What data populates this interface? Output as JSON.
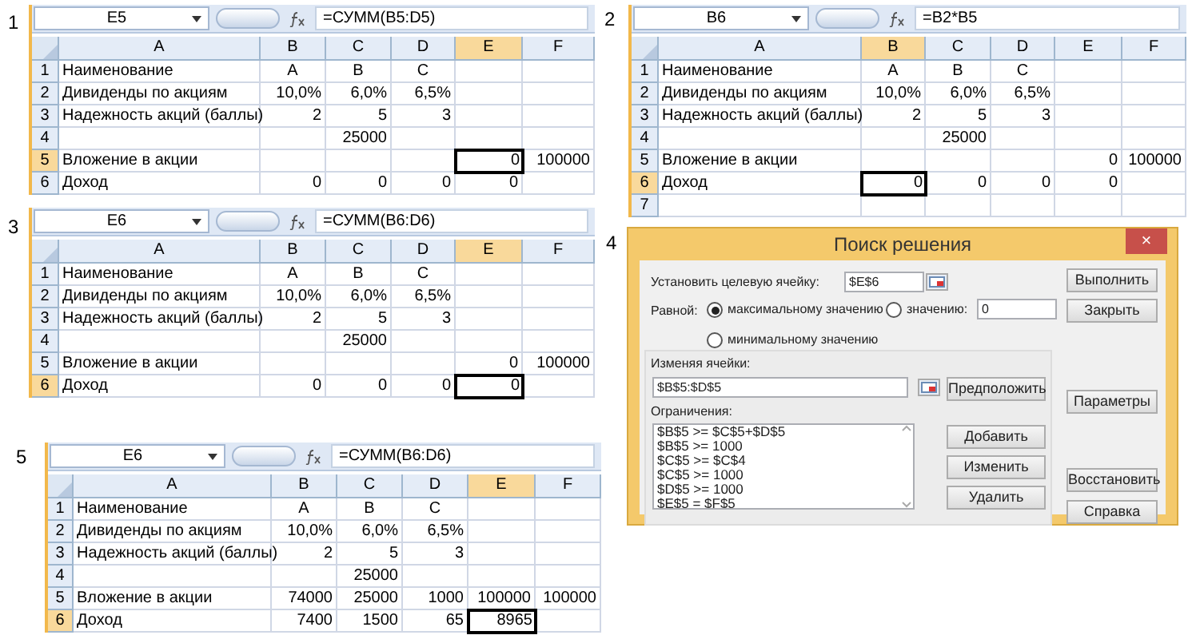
{
  "sheets": [
    {
      "label": "1",
      "name_box": "E5",
      "formula": "=СУММ(B5:D5)",
      "columns": [
        {
          "name": "A",
          "selected": false
        },
        {
          "name": "B",
          "selected": false
        },
        {
          "name": "C",
          "selected": false
        },
        {
          "name": "D",
          "selected": false
        },
        {
          "name": "E",
          "selected": true
        },
        {
          "name": "F",
          "selected": false
        }
      ],
      "rows": [
        {
          "number": "1",
          "selected": false,
          "cells": [
            "Наименование",
            "A",
            "B",
            "C",
            null,
            null
          ]
        },
        {
          "number": "2",
          "selected": false,
          "cells": [
            "Дивиденды по акциям",
            "10,0%",
            "6,0%",
            "6,5%",
            null,
            null
          ]
        },
        {
          "number": "3",
          "selected": false,
          "cells": [
            "Надежность акций (баллы)",
            "2",
            "5",
            "3",
            null,
            null
          ]
        },
        {
          "number": "4",
          "selected": false,
          "cells": [
            null,
            null,
            "25000",
            null,
            null,
            null
          ]
        },
        {
          "number": "5",
          "selected": true,
          "cells": [
            "Вложение в акции",
            null,
            null,
            null,
            "0",
            "100000"
          ]
        },
        {
          "number": "6",
          "selected": false,
          "cells": [
            "Доход",
            "0",
            "0",
            "0",
            "0",
            null
          ]
        }
      ]
    },
    {
      "label": "2",
      "name_box": "B6",
      "formula": "=B2*B5",
      "columns": [
        {
          "name": "A",
          "selected": false
        },
        {
          "name": "B",
          "selected": true
        },
        {
          "name": "C",
          "selected": false
        },
        {
          "name": "D",
          "selected": false
        },
        {
          "name": "E",
          "selected": false
        },
        {
          "name": "F",
          "selected": false
        }
      ],
      "rows": [
        {
          "number": "1",
          "selected": false,
          "cells": [
            "Наименование",
            "A",
            "B",
            "C",
            null,
            null
          ]
        },
        {
          "number": "2",
          "selected": false,
          "cells": [
            "Дивиденды по акциям",
            "10,0%",
            "6,0%",
            "6,5%",
            null,
            null
          ]
        },
        {
          "number": "3",
          "selected": false,
          "cells": [
            "Надежность акций (баллы)",
            "2",
            "5",
            "3",
            null,
            null
          ]
        },
        {
          "number": "4",
          "selected": false,
          "cells": [
            null,
            null,
            "25000",
            null,
            null,
            null
          ]
        },
        {
          "number": "5",
          "selected": false,
          "cells": [
            "Вложение в акции",
            null,
            null,
            null,
            "0",
            "100000"
          ]
        },
        {
          "number": "6",
          "selected": true,
          "cells": [
            "Доход",
            "0",
            "0",
            "0",
            "0",
            null
          ]
        },
        {
          "number": "7",
          "selected": false,
          "cells": [
            null,
            null,
            null,
            null,
            null,
            null
          ]
        }
      ]
    },
    {
      "label": "3",
      "name_box": "E6",
      "formula": "=СУММ(B6:D6)",
      "columns": [
        {
          "name": "A",
          "selected": false
        },
        {
          "name": "B",
          "selected": false
        },
        {
          "name": "C",
          "selected": false
        },
        {
          "name": "D",
          "selected": false
        },
        {
          "name": "E",
          "selected": true
        },
        {
          "name": "F",
          "selected": false
        }
      ],
      "rows": [
        {
          "number": "1",
          "selected": false,
          "cells": [
            "Наименование",
            "A",
            "B",
            "C",
            null,
            null
          ]
        },
        {
          "number": "2",
          "selected": false,
          "cells": [
            "Дивиденды по акциям",
            "10,0%",
            "6,0%",
            "6,5%",
            null,
            null
          ]
        },
        {
          "number": "3",
          "selected": false,
          "cells": [
            "Надежность акций (баллы)",
            "2",
            "5",
            "3",
            null,
            null
          ]
        },
        {
          "number": "4",
          "selected": false,
          "cells": [
            null,
            null,
            "25000",
            null,
            null,
            null
          ]
        },
        {
          "number": "5",
          "selected": false,
          "cells": [
            "Вложение в акции",
            null,
            null,
            null,
            "0",
            "100000"
          ]
        },
        {
          "number": "6",
          "selected": true,
          "cells": [
            "Доход",
            "0",
            "0",
            "0",
            "0",
            null
          ]
        }
      ]
    },
    {
      "label": "5",
      "name_box": "E6",
      "formula": "=СУММ(B6:D6)",
      "columns": [
        {
          "name": "A",
          "selected": false
        },
        {
          "name": "B",
          "selected": false
        },
        {
          "name": "C",
          "selected": false
        },
        {
          "name": "D",
          "selected": false
        },
        {
          "name": "E",
          "selected": true
        },
        {
          "name": "F",
          "selected": false
        }
      ],
      "rows": [
        {
          "number": "1",
          "selected": false,
          "cells": [
            "Наименование",
            "A",
            "B",
            "C",
            null,
            null
          ]
        },
        {
          "number": "2",
          "selected": false,
          "cells": [
            "Дивиденды по акциям",
            "10,0%",
            "6,0%",
            "6,5%",
            null,
            null
          ]
        },
        {
          "number": "3",
          "selected": false,
          "cells": [
            "Надежность акций (баллы)",
            "2",
            "5",
            "3",
            null,
            null
          ]
        },
        {
          "number": "4",
          "selected": false,
          "cells": [
            null,
            null,
            "25000",
            null,
            null,
            null
          ]
        },
        {
          "number": "5",
          "selected": false,
          "cells": [
            "Вложение в акции",
            "74000",
            "25000",
            "1000",
            "100000",
            "100000"
          ]
        },
        {
          "number": "6",
          "selected": true,
          "cells": [
            "Доход",
            "7400",
            "1500",
            "65",
            "8965",
            null
          ]
        }
      ]
    }
  ],
  "solver_dialog": {
    "label": "4",
    "title": "Поиск решения",
    "close": "×",
    "target_label": "Установить целевую ячейку:",
    "target_value": "$E$6",
    "equal_label": "Равной:",
    "options": [
      {
        "label": "максимальному значению",
        "selected": true
      },
      {
        "label": "значению:",
        "selected": false
      },
      {
        "label": "минимальному значению",
        "selected": false
      }
    ],
    "value_field": "0",
    "changing_label": "Изменяя ячейки:",
    "changing_value": "$B$5:$D$5",
    "guess_button": "Предположить",
    "constraints_label": "Ограничения:",
    "constraints": [
      "$B$5 >= $C$5+$D$5",
      "$B$5 >= 1000",
      "$C$5 >= $C$4",
      "$C$5 >= 1000",
      "$D$5 >= 1000",
      "$E$5 = $F$5"
    ],
    "list_buttons": [
      "Добавить",
      "Изменить",
      "Удалить"
    ],
    "side_buttons": [
      "Выполнить",
      "Закрыть",
      "Параметры",
      "Восстановить",
      "Справка"
    ]
  }
}
